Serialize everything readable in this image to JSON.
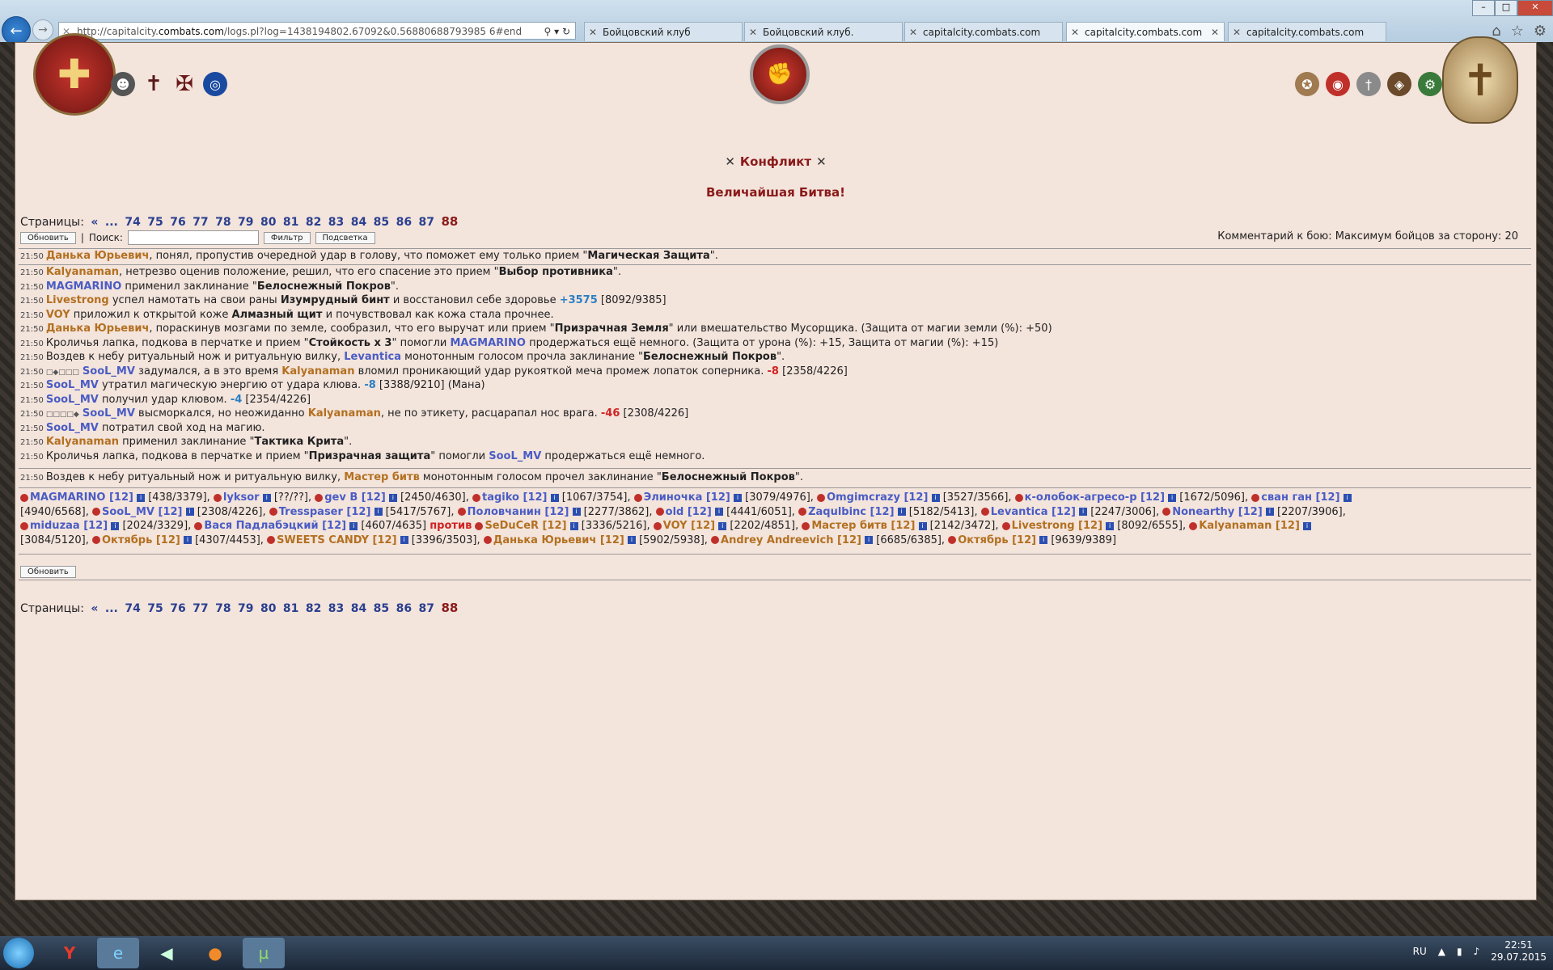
{
  "browser": {
    "url_prefix": "http://capitalcity.",
    "url_domain": "combats.com",
    "url_rest": "/logs.pl?log=1438194802.67092&0.56880688793985 6#end",
    "tabs": [
      "Бойцовский клуб",
      "Бойцовский клуб.",
      "capitalcity.combats.com",
      "capitalcity.combats.com",
      "capitalcity.combats.com"
    ]
  },
  "header": {
    "title": "Конфликт",
    "subtitle": "Величайшая Битва!"
  },
  "pages": {
    "label": "Страницы:",
    "prev": "«",
    "dots": "...",
    "links": [
      "74",
      "75",
      "76",
      "77",
      "78",
      "79",
      "80",
      "81",
      "82",
      "83",
      "84",
      "85",
      "86",
      "87"
    ],
    "current": "88"
  },
  "controls": {
    "refresh": "Обновить",
    "separator": "|",
    "search_label": "Поиск:",
    "filter": "Фильтр",
    "highlight": "Подсветка",
    "comment": "Комментарий к бою: Максимум бойцов за сторону: 20"
  },
  "log": [
    {
      "time": "21:50",
      "name": "Данька Юрьевич",
      "nc": "c1",
      "text": ", понял, пропустив очередной удар в голову, что поможет ему только прием \"",
      "bold": "Магическая Защита",
      "tail": "\"."
    },
    {
      "time": "21:50",
      "name": "Kalyanaman",
      "nc": "c1",
      "text": ", нетрезво оценив положение, решил, что его спасение это прием \"",
      "bold": "Выбор противника",
      "tail": "\"."
    },
    {
      "time": "21:50",
      "name": "MAGMARINO",
      "nc": "c2",
      "text": " применил заклинание \"",
      "bold": "Белоснежный Покров",
      "tail": "\"."
    },
    {
      "time": "21:50",
      "name": "Livestrong",
      "nc": "c1",
      "text": " успел намотать на свои раны ",
      "bold": "Изумрудный бинт",
      "tail": " и восстановил себе здоровье ",
      "val": "+3575",
      "vc": "bl",
      "after": " [8092/9385]"
    },
    {
      "time": "21:50",
      "name": "VOY",
      "nc": "c1",
      "text": " приложил к открытой коже ",
      "bold": "Алмазный щит",
      "tail": " и почувствовал как кожа стала прочнее."
    },
    {
      "time": "21:50",
      "name": "Данька Юрьевич",
      "nc": "c1",
      "text": ", пораскинув мозгами по земле, сообразил, что его выручат или прием \"",
      "bold": "Призрачная Земля",
      "tail": "\" или вмешательство Мусорщика. (Защита от магии земли (%): +50)"
    },
    {
      "time": "21:50",
      "pre": "Кроличья лапка, подкова в перчатке и прием \"",
      "bold": "Стойкость x 3",
      "tail": "\" помогли ",
      "name2": "MAGMARINO",
      "after": " продержаться ещё немного. (Защита от урона (%): +15, Защита от магии (%): +15)"
    },
    {
      "time": "21:50",
      "pre": "Воздев к небу ритуальный нож и ритуальную вилку, ",
      "name2": "Levantica",
      "after": " монотонным голосом прочла заклинание \"",
      "bold2": "Белоснежный Покров",
      "end": "\"."
    },
    {
      "time": "21:50",
      "sq": "□◆□□□",
      "name": "SooL_MV",
      "nc": "c2",
      "text": " задумался, а в это время ",
      "name3": "Kalyanaman",
      "after": " вломил проникающий удар рукояткой меча промеж лопаток соперника. ",
      "val": "-8",
      "vc": "rd",
      "end": " [2358/4226]"
    },
    {
      "time": "21:50",
      "name": "SooL_MV",
      "nc": "c2",
      "text": " утратил магическую энергию от удара клюва. ",
      "val": "-8",
      "vc": "bl",
      "end": " [3388/9210] (Мана)"
    },
    {
      "time": "21:50",
      "name": "SooL_MV",
      "nc": "c2",
      "text": " получил удар клювом. ",
      "val": "-4",
      "vc": "bl",
      "end": " [2354/4226]"
    },
    {
      "time": "21:50",
      "sq": "□□□□◆",
      "name": "SooL_MV",
      "nc": "c2",
      "text": " высморкался, но неожиданно ",
      "name3": "Kalyanaman",
      "after": ", не по этикету, расцарапал нос врага. ",
      "val": "-46",
      "vc": "rd",
      "end": " [2308/4226]"
    },
    {
      "time": "21:50",
      "name": "SooL_MV",
      "nc": "c2",
      "text": " потратил свой ход на магию."
    },
    {
      "time": "21:50",
      "name": "Kalyanaman",
      "nc": "c1",
      "text": " применил заклинание \"",
      "bold": "Тактика Крита",
      "tail": "\"."
    },
    {
      "time": "21:50",
      "pre": "Кроличья лапка, подкова в перчатке и прием \"",
      "bold": "Призрачная защита",
      "tail": "\" помогли ",
      "name2": "SooL_MV",
      "after": " продержаться ещё немного."
    }
  ],
  "last_log": {
    "time": "21:50",
    "pre": "Воздев к небу ритуальный нож и ритуальную вилку, ",
    "name": "Мастер битв",
    "after": " монотонным голосом прочел заклинание \"",
    "bold": "Белоснежный Покров",
    "end": "\"."
  },
  "teams_line1": [
    {
      "name": "MAGMARINO [12]",
      "c": "c2",
      "hp": "[438/3379],"
    },
    {
      "name": "lyksor",
      "c": "c2",
      "hp": "[??/??],"
    },
    {
      "name": "gev B [12]",
      "c": "c2",
      "hp": "[2450/4630],"
    },
    {
      "name": "tagiko [12]",
      "c": "c2",
      "hp": "[1067/3754],"
    },
    {
      "name": "Элиночка [12]",
      "c": "c2",
      "hp": "[3079/4976],"
    },
    {
      "name": "Omgimcrazy [12]",
      "c": "c2",
      "hp": "[3527/3566],"
    },
    {
      "name": "к-олобок-агресо-р [12]",
      "c": "c2",
      "hp": "[1672/5096],"
    },
    {
      "name": "сван ган [12]",
      "c": "c2",
      "hp": ""
    }
  ],
  "teams_line2": [
    {
      "name": "",
      "c": "c2",
      "hp": "[4940/6568],"
    },
    {
      "name": "SooL_MV [12]",
      "c": "c2",
      "hp": "[2308/4226],"
    },
    {
      "name": "Tresspaser [12]",
      "c": "c2",
      "hp": "[5417/5767],"
    },
    {
      "name": "Половчанин [12]",
      "c": "c2",
      "hp": "[2277/3862],"
    },
    {
      "name": "old [12]",
      "c": "c2",
      "hp": "[4441/6051],"
    },
    {
      "name": "Zaqulbinc [12]",
      "c": "c2",
      "hp": "[5182/5413],"
    },
    {
      "name": "Levantica [12]",
      "c": "c2",
      "hp": "[2247/3006],"
    },
    {
      "name": "Nonearthy [12]",
      "c": "c2",
      "hp": "[2207/3906],"
    }
  ],
  "teams_line3": [
    {
      "name": "miduzaa [12]",
      "c": "c2",
      "hp": "[2024/3329],"
    },
    {
      "name": "Вася Падлабэцкий [12]",
      "c": "c2",
      "hp": "[4607/4635]"
    },
    {
      "name": "против",
      "c": "pr",
      "hp": ""
    },
    {
      "name": "SeDuCeR [12]",
      "c": "c1",
      "hp": "[3336/5216],"
    },
    {
      "name": "VOY [12]",
      "c": "c1",
      "hp": "[2202/4851],"
    },
    {
      "name": "Мастер битв [12]",
      "c": "c1",
      "hp": "[2142/3472],"
    },
    {
      "name": "Livestrong [12]",
      "c": "c1",
      "hp": "[8092/6555],"
    },
    {
      "name": "Kalyanaman [12]",
      "c": "c1",
      "hp": ""
    }
  ],
  "teams_line4": [
    {
      "name": "",
      "c": "c1",
      "hp": "[3084/5120],"
    },
    {
      "name": "Октябрь [12]",
      "c": "c1",
      "hp": "[4307/4453],"
    },
    {
      "name": "SWEETS CANDY [12]",
      "c": "c1",
      "hp": "[3396/3503],"
    },
    {
      "name": "Данька Юрьевич [12]",
      "c": "c1",
      "hp": "[5902/5938],"
    },
    {
      "name": "Andrey Andreevich [12]",
      "c": "c1",
      "hp": "[6685/6385],"
    },
    {
      "name": "Октябрь [12]",
      "c": "c1",
      "hp": "[9639/9389]"
    }
  ],
  "taskbar": {
    "lang": "RU",
    "time": "22:51",
    "date": "29.07.2015"
  }
}
